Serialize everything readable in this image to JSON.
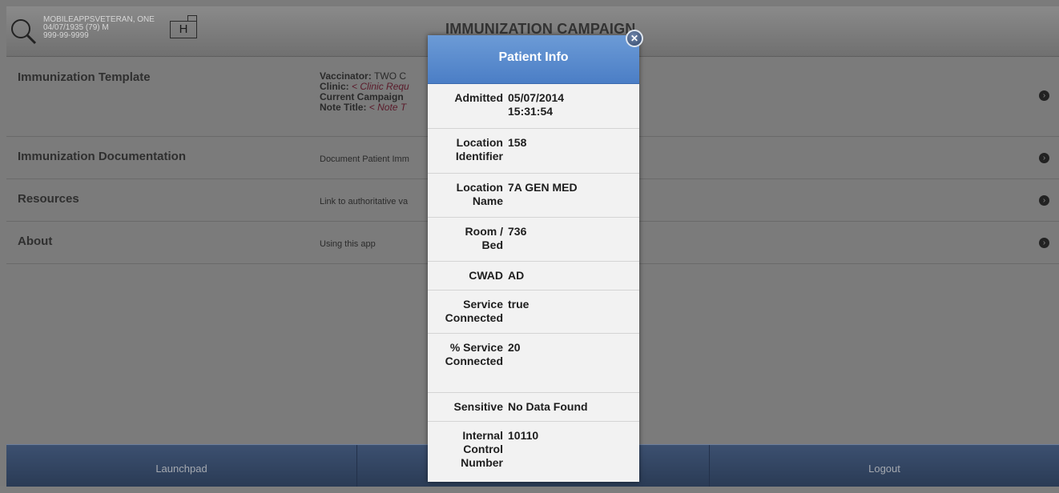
{
  "header": {
    "patient_name": "MOBILEAPPSVETERAN, ONE",
    "patient_dob": "04/07/1935 (79) M",
    "patient_ssn": "999-99-9999",
    "badge": "H",
    "title": "IMMUNIZATION CAMPAIGN"
  },
  "menu": {
    "template": {
      "title": "Immunization Template",
      "vaccinator_label": "Vaccinator:",
      "vaccinator_value": "TWO C",
      "clinic_label": "Clinic:",
      "clinic_value": "< Clinic Requ",
      "campaign_label": "Current Campaign",
      "note_label": "Note Title:",
      "note_value": "< Note T"
    },
    "documentation": {
      "title": "Immunization Documentation",
      "desc": "Document Patient Imm"
    },
    "resources": {
      "title": "Resources",
      "desc": "Link to authoritative va"
    },
    "about": {
      "title": "About",
      "desc": "Using this app"
    }
  },
  "footer": {
    "tab1": "Launchpad",
    "tab2": "",
    "tab3": "Logout"
  },
  "popup": {
    "title": "Patient Info",
    "close_icon": "close-icon",
    "rows": [
      {
        "label": "Admitted",
        "value": "05/07/2014 15:31:54"
      },
      {
        "label": "Location Identifier",
        "value": "158"
      },
      {
        "label": "Location Name",
        "value": "7A GEN MED"
      },
      {
        "label": "Room / Bed",
        "value": "736"
      },
      {
        "label": "CWAD",
        "value": "AD"
      },
      {
        "label": "Service Connected",
        "value": "true"
      },
      {
        "label": "% Service Connected",
        "value": "20"
      },
      {
        "label": "Sensitive",
        "value": "No Data Found"
      },
      {
        "label": "Internal Control Number",
        "value": "10110"
      }
    ]
  },
  "colors": {
    "popup_header": "#5a8ccd",
    "footer": "#34465f",
    "background": "#7b7b7b"
  }
}
